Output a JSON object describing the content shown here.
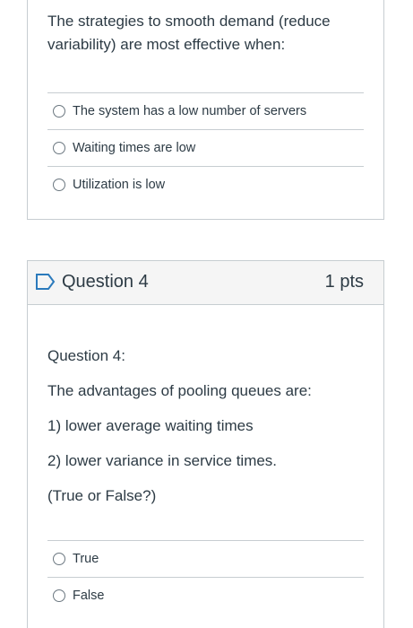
{
  "question3": {
    "text": "The strategies to smooth demand (reduce variability) are most effective when:",
    "answers": [
      {
        "label": "The system has a low number of servers"
      },
      {
        "label": "Waiting times are low"
      },
      {
        "label": "Utilization is low"
      }
    ]
  },
  "question4": {
    "title": "Question 4",
    "points": "1 pts",
    "flag_icon": "flag-outline-icon",
    "paragraphs": [
      "Question 4:",
      "The advantages of pooling queues are:",
      "1) lower average waiting times",
      "2) lower variance in service times.",
      "(True or False?)"
    ],
    "answers": [
      {
        "label": "True"
      },
      {
        "label": "False"
      }
    ]
  },
  "colors": {
    "border": "#c7cdd1",
    "header_bg": "#f5f5f5",
    "text": "#2d3b45",
    "flag": "#2b7abc"
  }
}
